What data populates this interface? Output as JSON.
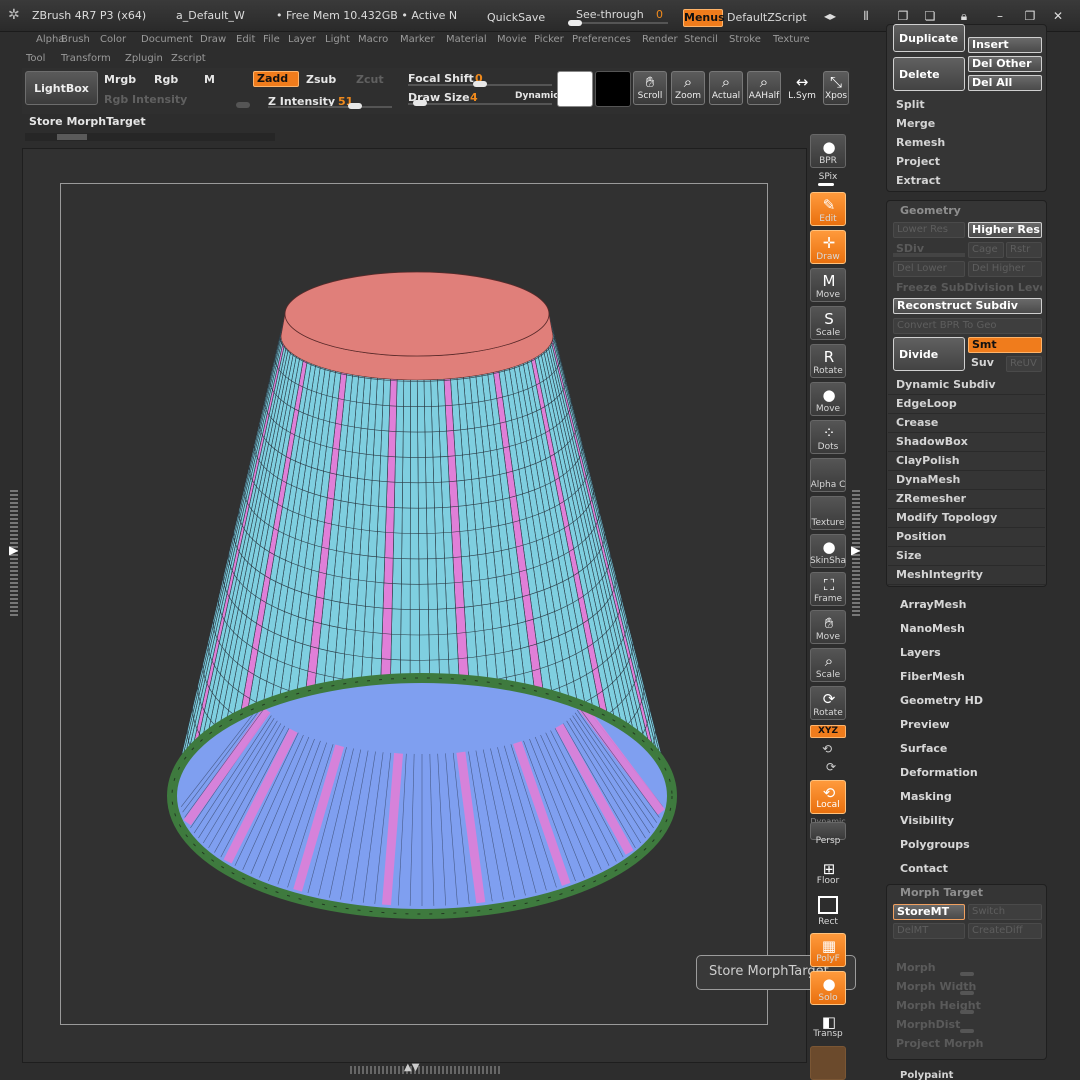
{
  "titlebar": {
    "app": "ZBrush 4R7 P3 (x64)",
    "doc": "a_Default_W",
    "mem": "• Free Mem 10.432GB • Active N",
    "quicksave": "QuickSave",
    "seethrough_label": "See-through",
    "seethrough_value": "0",
    "menus": "Menus",
    "script": "DefaultZScript"
  },
  "menus": {
    "row1": [
      "Alpha",
      "Brush",
      "Color",
      "Document",
      "Draw",
      "Edit",
      "File",
      "Layer",
      "Light",
      "Macro",
      "Marker",
      "Material",
      "Movie",
      "Picker",
      "Preferences",
      "Render",
      "Stencil",
      "Stroke",
      "Texture"
    ],
    "row2": [
      "Tool",
      "Transform",
      "Zplugin",
      "Zscript"
    ]
  },
  "shelf": {
    "lightbox": "LightBox",
    "mrgb": "Mrgb",
    "rgb": "Rgb",
    "m": "M",
    "zadd": "Zadd",
    "zsub": "Zsub",
    "zcut": "Zcut",
    "rgb_intensity": "Rgb Intensity",
    "z_intensity_label": "Z Intensity",
    "z_intensity_value": "51",
    "focal_shift_label": "Focal Shift",
    "focal_shift_value": "0",
    "draw_size_label": "Draw Size",
    "draw_size_value": "4",
    "dynamic": "Dynamic",
    "scroll": "Scroll",
    "zoom": "Zoom",
    "actual": "Actual",
    "aahalf": "AAHalf",
    "lsym": "L.Sym",
    "xpose": "Xpos",
    "store_morph": "Store MorphTarget"
  },
  "colors": {
    "accent": "#f07c1c",
    "mesh_cyan": "#7fcfe0",
    "mesh_pink": "#e07fd8",
    "mesh_top": "#e07f7a",
    "mesh_rim": "#3e7a3e",
    "mesh_inner": "#7f9ff0"
  },
  "right_shelf": {
    "bpr": "BPR",
    "spix": "SPix",
    "edit": "Edit",
    "draw": "Draw",
    "move": "Move",
    "scale": "Scale",
    "rotate": "Rotate",
    "move2": "Move",
    "dots": "Dots",
    "alpha": "Alpha  C",
    "texture": "Texture",
    "skinsha": "SkinSha",
    "frame": "Frame",
    "move3": "Move",
    "scale2": "Scale",
    "rotate2": "Rotate",
    "xyz": "XYZ",
    "local": "Local",
    "dynamic": "Dynamic",
    "persp": "Persp",
    "floor": "Floor",
    "rect": "Rect",
    "polyf": "PolyF",
    "solo": "Solo",
    "transp": "Transp"
  },
  "panel": {
    "duplicate": "Duplicate",
    "insert": "Insert",
    "delete": "Delete",
    "del_other": "Del Other",
    "del_all": "Del All",
    "split": "Split",
    "merge": "Merge",
    "remesh": "Remesh",
    "project": "Project",
    "extract": "Extract",
    "geometry": "Geometry",
    "lower_res": "Lower Res",
    "higher_res": "Higher Res",
    "sdiv": "SDiv",
    "cage": "Cage",
    "rstr": "Rstr",
    "del_lower": "Del Lower",
    "del_higher": "Del Higher",
    "freeze": "Freeze SubDivision Levels",
    "reconstruct": "Reconstruct Subdiv",
    "convert": "Convert BPR To Geo",
    "divide": "Divide",
    "smt": "Smt",
    "suv": "Suv",
    "reuv": "ReUV",
    "geo_items": [
      "Dynamic Subdiv",
      "EdgeLoop",
      "Crease",
      "ShadowBox",
      "ClayPolish",
      "DynaMesh",
      "ZRemesher",
      "Modify Topology",
      "Position",
      "Size",
      "MeshIntegrity"
    ],
    "sub_items": [
      "ArrayMesh",
      "NanoMesh",
      "Layers",
      "FiberMesh",
      "Geometry HD",
      "Preview",
      "Surface",
      "Deformation",
      "Masking",
      "Visibility",
      "Polygroups",
      "Contact"
    ],
    "morph_target": "Morph Target",
    "storemt": "StoreMT",
    "switch": "Switch",
    "delmt": "DelMT",
    "creatediff": "CreateDiff",
    "morph": "Morph",
    "morph_width": "Morph Width",
    "morph_height": "Morph Height",
    "morph_dist": "MorphDist",
    "project_morph": "Project Morph",
    "polypaint": "Polypaint"
  },
  "tooltip": "Store MorphTarget"
}
